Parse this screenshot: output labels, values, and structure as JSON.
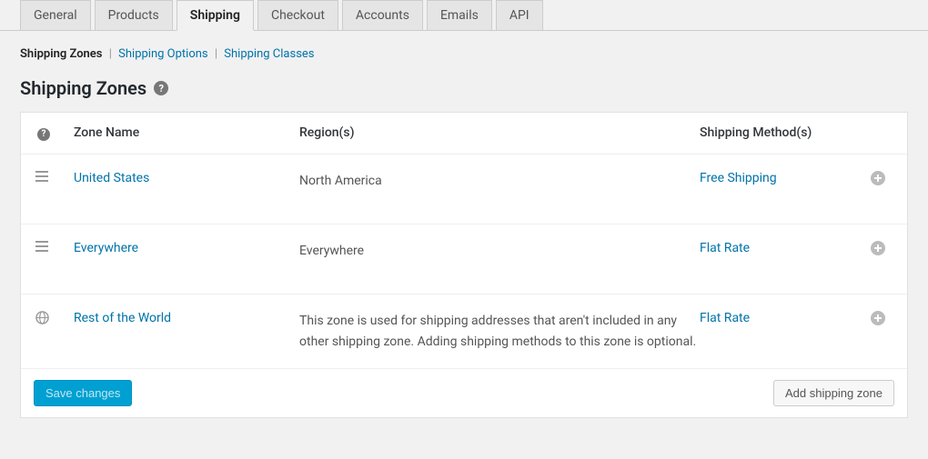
{
  "tabs": [
    "General",
    "Products",
    "Shipping",
    "Checkout",
    "Accounts",
    "Emails",
    "API"
  ],
  "active_tab": "Shipping",
  "subnav": {
    "current": "Shipping Zones",
    "links": [
      "Shipping Options",
      "Shipping Classes"
    ]
  },
  "page_title": "Shipping Zones",
  "columns": {
    "zone": "Zone Name",
    "region": "Region(s)",
    "methods": "Shipping Method(s)"
  },
  "rows": [
    {
      "icon": "drag",
      "zone": "United States",
      "region": "North America",
      "method": "Free Shipping"
    },
    {
      "icon": "drag",
      "zone": "Everywhere",
      "region": "Everywhere",
      "method": "Flat Rate"
    },
    {
      "icon": "globe",
      "zone": "Rest of the World",
      "region": "This zone is used for shipping addresses that aren't included in any other shipping zone. Adding shipping methods to this zone is optional.",
      "method": "Flat Rate"
    }
  ],
  "buttons": {
    "save": "Save changes",
    "add_zone": "Add shipping zone"
  }
}
